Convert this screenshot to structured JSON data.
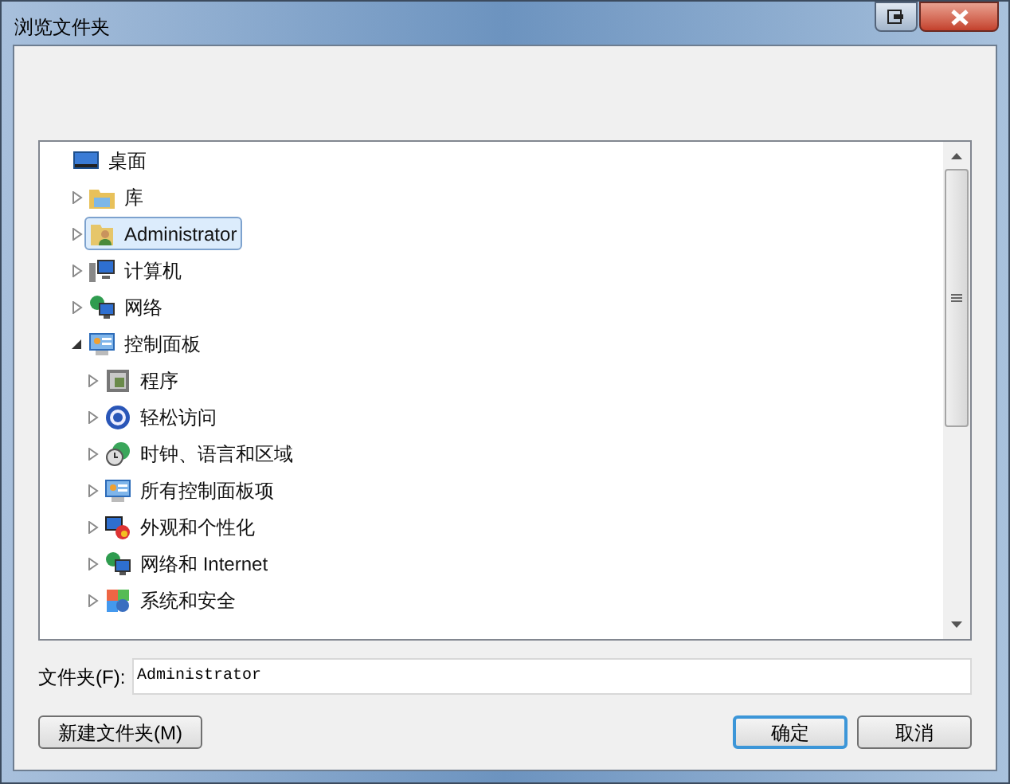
{
  "window": {
    "title": "浏览文件夹"
  },
  "tree": [
    {
      "label": "桌面",
      "kind": "desktop",
      "selected": false,
      "children": [
        {
          "label": "库",
          "kind": "library",
          "expanded": false,
          "selected": false
        },
        {
          "label": "Administrator",
          "kind": "user",
          "expanded": false,
          "selected": true
        },
        {
          "label": "计算机",
          "kind": "computer",
          "expanded": false,
          "selected": false
        },
        {
          "label": "网络",
          "kind": "network",
          "expanded": false,
          "selected": false
        },
        {
          "label": "控制面板",
          "kind": "panel",
          "expanded": true,
          "selected": false,
          "children": [
            {
              "label": "程序",
              "kind": "programs",
              "expanded": false,
              "selected": false
            },
            {
              "label": "轻松访问",
              "kind": "access",
              "expanded": false,
              "selected": false
            },
            {
              "label": "时钟、语言和区域",
              "kind": "clock",
              "expanded": false,
              "selected": false
            },
            {
              "label": "所有控制面板项",
              "kind": "panel",
              "expanded": false,
              "selected": false
            },
            {
              "label": "外观和个性化",
              "kind": "appearance",
              "expanded": false,
              "selected": false
            },
            {
              "label": "网络和 Internet",
              "kind": "network",
              "expanded": false,
              "selected": false
            },
            {
              "label": "系统和安全",
              "kind": "security",
              "expanded": false,
              "selected": false
            }
          ]
        }
      ]
    }
  ],
  "folder_field": {
    "label": "文件夹(F):",
    "value": "Administrator"
  },
  "buttons": [
    {
      "label": "新建文件夹(M)",
      "default": false
    },
    {
      "label": "确定",
      "default": true
    },
    {
      "label": "取消",
      "default": false
    }
  ]
}
